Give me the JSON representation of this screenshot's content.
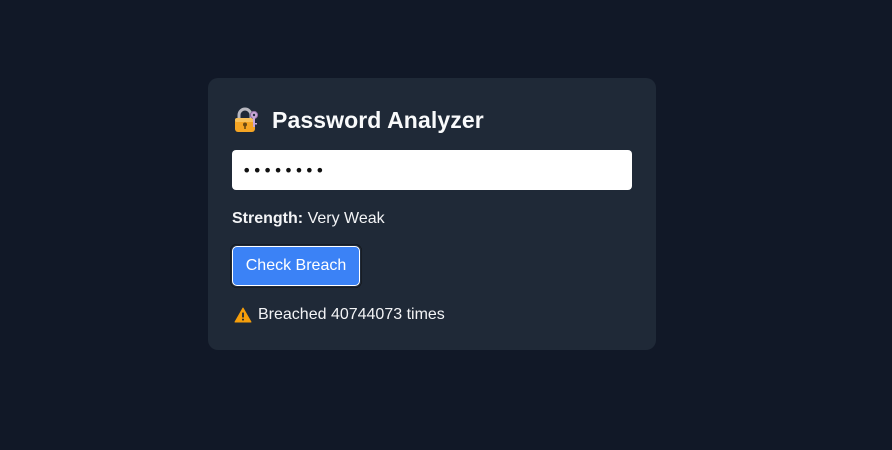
{
  "app": {
    "title": "Password Analyzer",
    "title_icon": "lock-with-key-icon"
  },
  "password": {
    "masked_value": "••••••••",
    "type": "password"
  },
  "strength": {
    "label": "Strength:",
    "value": "Very Weak"
  },
  "actions": {
    "check_breach_label": "Check Breach"
  },
  "result": {
    "icon": "warning-icon",
    "text": "Breached 40744073 times"
  },
  "colors": {
    "background": "#111827",
    "card": "#1f2937",
    "accent": "#3b82f6",
    "warning": "#f59e0b"
  }
}
